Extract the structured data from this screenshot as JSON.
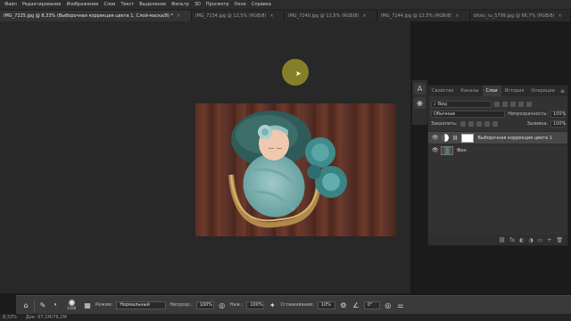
{
  "menu": [
    "Файл",
    "Редактирование",
    "Изображение",
    "Слои",
    "Текст",
    "Выделение",
    "Фильтр",
    "3D",
    "Просмотр",
    "Окно",
    "Справка"
  ],
  "tabs": [
    {
      "label": "IMG_7225.jpg @ 8,33% (Выборочная коррекция цвета 1, Слой-маска/8) *",
      "active": true
    },
    {
      "label": "IMG_7234.jpg @ 12,5% (RGB/8)",
      "active": false
    },
    {
      "label": "IMG_7240.jpg @ 12,5% (RGB/8)",
      "active": false
    },
    {
      "label": "IMG_7244.jpg @ 12,5% (RGB/8)",
      "active": false
    },
    {
      "label": "bfoto_ru_5799.jpg @ 66,7% (RGB/8)",
      "active": false
    }
  ],
  "tab_close": "×",
  "panel": {
    "tabs": [
      "Свойства",
      "Каналы",
      "Слои",
      "История",
      "Операции"
    ],
    "active_tab": "Слои",
    "menu_icon": "≡",
    "filter_label": "Вид",
    "blend_mode": "Обычные",
    "opacity_label": "Непрозрачность:",
    "opacity_value": "100%",
    "lock_label": "Закрепить:",
    "fill_label": "Заливка:",
    "fill_value": "100%",
    "layers": [
      {
        "name": "Выборочная коррекция цвета 1",
        "type": "adjustment",
        "selected": true
      },
      {
        "name": "Фон",
        "type": "photo",
        "selected": false
      }
    ],
    "footer_icons": [
      "⛓",
      "fx",
      "◐",
      "◑",
      "▭",
      "+",
      "🗑"
    ]
  },
  "side_buttons": [
    "A",
    "◉"
  ],
  "options": {
    "mode_label": "Режим:",
    "mode_value": "Нормальный",
    "brush_size": "1438",
    "opacity_label": "Непрозр.:",
    "opacity_value": "100%",
    "press_label": "Наж.:",
    "press_value": "100%",
    "smooth_label": "Сглаживание:",
    "smooth_value": "10%",
    "angle_value": "0°"
  },
  "status": {
    "zoom": "8,33%",
    "doc": "Док: 67,1M/76,1M"
  },
  "colors": {
    "accent": "#c8c832",
    "panel": "#323232",
    "background": "#282828"
  }
}
